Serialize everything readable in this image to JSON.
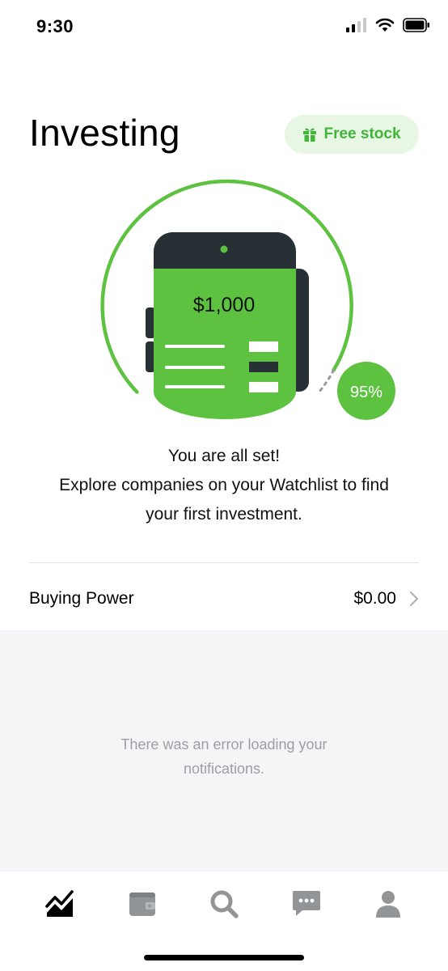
{
  "status_bar": {
    "time": "9:30"
  },
  "header": {
    "title": "Investing",
    "free_stock_label": "Free stock"
  },
  "illustration": {
    "amount": "$1,000",
    "progress_label": "95%",
    "progress": 0.95,
    "accent": "#5cc23f",
    "dark": "#273135"
  },
  "message": {
    "line1": "You are all set!",
    "line2": "Explore companies on your Watchlist to find",
    "line3": "your first investment."
  },
  "buying_power": {
    "label": "Buying Power",
    "value": "$0.00"
  },
  "notifications": {
    "error_line1": "There was an error loading your",
    "error_line2": "notifications."
  },
  "tab_bar": {
    "tabs": [
      {
        "icon": "chart-icon",
        "active": true
      },
      {
        "icon": "wallet-icon",
        "active": false
      },
      {
        "icon": "search-icon",
        "active": false
      },
      {
        "icon": "messages-icon",
        "active": false
      },
      {
        "icon": "account-icon",
        "active": false
      }
    ]
  }
}
